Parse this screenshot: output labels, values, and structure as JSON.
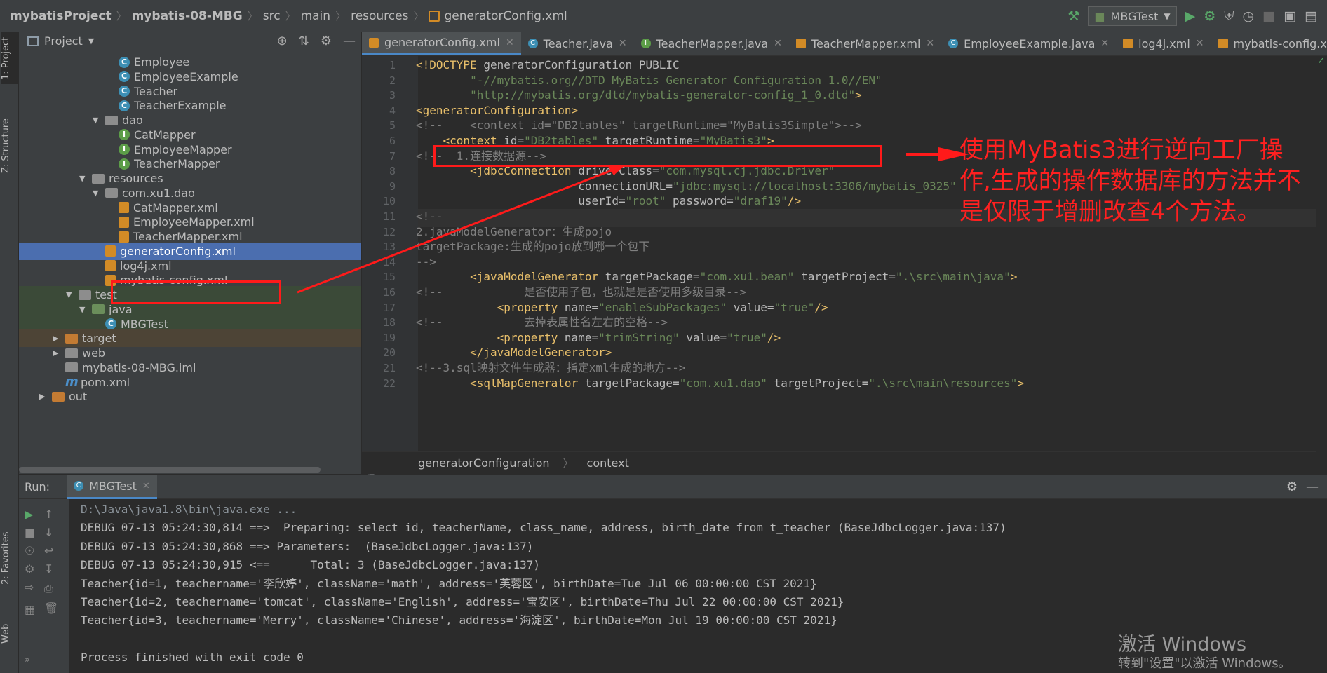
{
  "navbar": {
    "breadcrumb": [
      "mybatisProject",
      "mybatis-08-MBG",
      "src",
      "main",
      "resources",
      "generatorConfig.xml"
    ],
    "run_config": "MBGTest"
  },
  "sidebar_tabs": [
    "1: Project",
    "Z: Structure",
    "2: Favorites",
    "Web"
  ],
  "project_panel": {
    "title": "Project",
    "tree": [
      {
        "label": "Employee",
        "icon": "class-icon",
        "indent": 3
      },
      {
        "label": "EmployeeExample",
        "icon": "class-icon",
        "indent": 3
      },
      {
        "label": "Teacher",
        "icon": "class-icon",
        "indent": 3
      },
      {
        "label": "TeacherExample",
        "icon": "class-icon",
        "indent": 3
      },
      {
        "label": "dao",
        "icon": "package-icon",
        "indent": 2,
        "expanded": true
      },
      {
        "label": "CatMapper",
        "icon": "interface-icon",
        "indent": 3
      },
      {
        "label": "EmployeeMapper",
        "icon": "interface-icon",
        "indent": 3
      },
      {
        "label": "TeacherMapper",
        "icon": "interface-icon",
        "indent": 3
      },
      {
        "label": "resources",
        "icon": "resources-folder-icon",
        "indent": 1,
        "expanded": true
      },
      {
        "label": "com.xu1.dao",
        "icon": "folder-icon",
        "indent": 2,
        "expanded": true
      },
      {
        "label": "CatMapper.xml",
        "icon": "xml-icon",
        "indent": 3
      },
      {
        "label": "EmployeeMapper.xml",
        "icon": "xml-icon",
        "indent": 3
      },
      {
        "label": "TeacherMapper.xml",
        "icon": "xml-icon",
        "indent": 3
      },
      {
        "label": "generatorConfig.xml",
        "icon": "xml-icon",
        "indent": 2,
        "selected": true
      },
      {
        "label": "log4j.xml",
        "icon": "xml-icon",
        "indent": 2
      },
      {
        "label": "mybatis-config.xml",
        "icon": "xml-icon",
        "indent": 2
      },
      {
        "label": "test",
        "icon": "folder-icon",
        "indent": 0,
        "expanded": true
      },
      {
        "label": "java",
        "icon": "test-folder-icon",
        "indent": 1,
        "expanded": true
      },
      {
        "label": "MBGTest",
        "icon": "class-icon",
        "indent": 2
      },
      {
        "label": "target",
        "icon": "excluded-folder-icon",
        "indent": -1,
        "expanded": false
      },
      {
        "label": "web",
        "icon": "web-folder-icon",
        "indent": -1,
        "expanded": false
      },
      {
        "label": "mybatis-08-MBG.iml",
        "icon": "iml-icon",
        "indent": -1
      },
      {
        "label": "pom.xml",
        "icon": "maven-icon",
        "indent": -1
      },
      {
        "label": "out",
        "icon": "excluded-folder-icon",
        "indent": -2,
        "expanded": false
      }
    ]
  },
  "editor": {
    "tabs": [
      {
        "label": "generatorConfig.xml",
        "icon": "xml-icon",
        "active": true
      },
      {
        "label": "Teacher.java",
        "icon": "class-icon"
      },
      {
        "label": "TeacherMapper.java",
        "icon": "interface-icon"
      },
      {
        "label": "TeacherMapper.xml",
        "icon": "xml-icon"
      },
      {
        "label": "EmployeeExample.java",
        "icon": "class-icon"
      },
      {
        "label": "log4j.xml",
        "icon": "xml-icon"
      },
      {
        "label": "mybatis-config.xml",
        "icon": "xml-icon"
      }
    ],
    "current_line": 11,
    "lines": [
      [
        [
          "tag",
          "<!DOCTYPE "
        ],
        [
          "attr",
          "generatorConfiguration PUBLIC"
        ]
      ],
      [
        [
          "val",
          "        \"-//mybatis.org//DTD MyBatis Generator Configuration 1.0//EN\""
        ]
      ],
      [
        [
          "val",
          "        \"http://mybatis.org/dtd/mybatis-generator-config_1_0.dtd\""
        ],
        [
          "tag",
          ">"
        ]
      ],
      [
        [
          "tag",
          "<generatorConfiguration>"
        ]
      ],
      [
        [
          "cm",
          "<!--    <context id=\"DB2tables\" targetRuntime=\"MyBatis3Simple\">-->"
        ]
      ],
      [
        [
          "tag",
          "    <context "
        ],
        [
          "attr",
          "id="
        ],
        [
          "val",
          "\"DB2tables\""
        ],
        [
          "attr",
          " targetRuntime="
        ],
        [
          "val",
          "\"MyBatis3\""
        ],
        [
          "tag",
          ">"
        ]
      ],
      [
        [
          "cm",
          "<!--  1.连接数据源-->"
        ]
      ],
      [
        [
          "tag",
          "        <jdbcConnection "
        ],
        [
          "attr",
          "driverClass="
        ],
        [
          "val",
          "\"com.mysql.cj.jdbc.Driver\""
        ]
      ],
      [
        [
          "attr",
          "                        connectionURL="
        ],
        [
          "val",
          "\"jdbc:mysql://localhost:3306/mybatis_0325\""
        ]
      ],
      [
        [
          "attr",
          "                        userId="
        ],
        [
          "val",
          "\"root\""
        ],
        [
          "attr",
          " password="
        ],
        [
          "val",
          "\"draf19\""
        ],
        [
          "tag",
          "/>"
        ]
      ],
      [
        [
          "cm",
          "<!--"
        ]
      ],
      [
        [
          "cm",
          "2.javaModelGenerator：生成pojo"
        ]
      ],
      [
        [
          "cm",
          "targetPackage:生成的pojo放到哪一个包下"
        ]
      ],
      [
        [
          "cm",
          "-->"
        ]
      ],
      [
        [
          "tag",
          "        <javaModelGenerator "
        ],
        [
          "attr",
          "targetPackage="
        ],
        [
          "val",
          "\"com.xu1.bean\""
        ],
        [
          "attr",
          " targetProject="
        ],
        [
          "val",
          "\".\\src\\main\\java\""
        ],
        [
          "tag",
          ">"
        ]
      ],
      [
        [
          "cm",
          "<!--            是否使用子包，也就是是否使用多级目录-->"
        ]
      ],
      [
        [
          "tag",
          "            <property "
        ],
        [
          "attr",
          "name="
        ],
        [
          "val",
          "\"enableSubPackages\""
        ],
        [
          "attr",
          " value="
        ],
        [
          "val",
          "\"true\""
        ],
        [
          "tag",
          "/>"
        ]
      ],
      [
        [
          "cm",
          "<!--            去掉表属性名左右的空格-->"
        ]
      ],
      [
        [
          "tag",
          "            <property "
        ],
        [
          "attr",
          "name="
        ],
        [
          "val",
          "\"trimString\""
        ],
        [
          "attr",
          " value="
        ],
        [
          "val",
          "\"true\""
        ],
        [
          "tag",
          "/>"
        ]
      ],
      [
        [
          "tag",
          "        </javaModelGenerator>"
        ]
      ],
      [
        [
          "cm",
          "<!--3.sql映射文件生成器：指定xml生成的地方-->"
        ]
      ],
      [
        [
          "tag",
          "        <sqlMapGenerator "
        ],
        [
          "attr",
          "targetPackage="
        ],
        [
          "val",
          "\"com.xu1.dao\""
        ],
        [
          "attr",
          " targetProject="
        ],
        [
          "val",
          "\".\\src\\main\\resources\""
        ],
        [
          "tag",
          ">"
        ]
      ]
    ],
    "breadcrumb": [
      "generatorConfiguration",
      "context"
    ]
  },
  "run_panel": {
    "label": "Run:",
    "tab": "MBGTest",
    "console": [
      "D:\\Java\\java1.8\\bin\\java.exe ...",
      "DEBUG 07-13 05:24:30,814 ==>  Preparing: select id, teacherName, class_name, address, birth_date from t_teacher (BaseJdbcLogger.java:137)",
      "DEBUG 07-13 05:24:30,868 ==> Parameters:  (BaseJdbcLogger.java:137)",
      "DEBUG 07-13 05:24:30,915 <==      Total: 3 (BaseJdbcLogger.java:137)",
      "Teacher{id=1, teachername='李欣婷', className='math', address='芙蓉区', birthDate=Tue Jul 06 00:00:00 CST 2021}",
      "Teacher{id=2, teachername='tomcat', className='English', address='宝安区', birthDate=Thu Jul 22 00:00:00 CST 2021}",
      "Teacher{id=3, teachername='Merry', className='Chinese', address='海淀区', birthDate=Mon Jul 19 00:00:00 CST 2021}",
      "",
      "Process finished with exit code 0"
    ]
  },
  "annotation": {
    "text": "使用MyBatis3进行逆向工厂操作,生成的操作数据库的方法并不是仅限于增删改查4个方法。",
    "color": "#ff2020"
  },
  "watermark": {
    "line1": "激活 Windows",
    "line2": "转到\"设置\"以激活 Windows。"
  }
}
